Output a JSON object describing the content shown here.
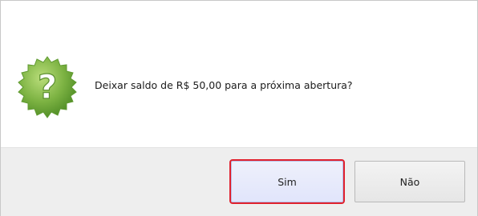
{
  "dialog": {
    "message": "Deixar saldo de R$ 50,00 para a próxima abertura?",
    "icon": "question-seal-icon",
    "icon_color": "#7db343",
    "buttons": {
      "yes_label": "Sim",
      "no_label": "Não"
    },
    "focus_outline_color": "#e0212e"
  }
}
